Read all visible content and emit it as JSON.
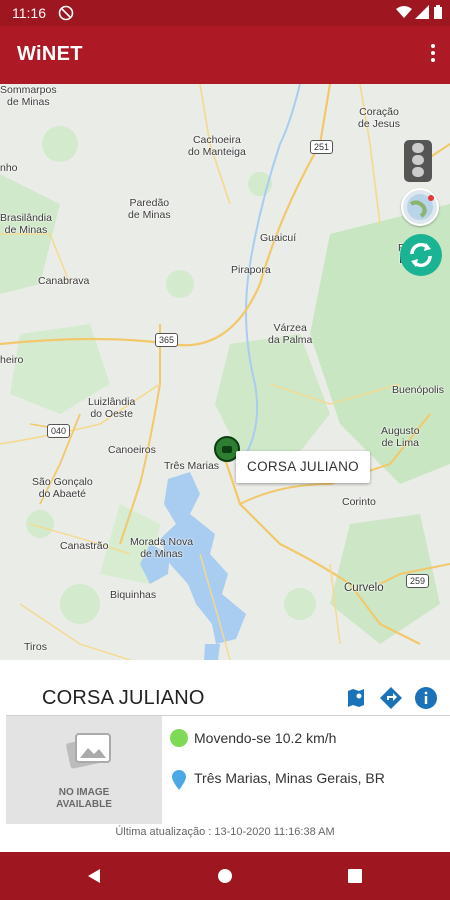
{
  "status_bar": {
    "time": "11:16",
    "icons": [
      "do-not-disturb-icon",
      "wifi-icon",
      "signal-icon",
      "battery-icon"
    ]
  },
  "app_bar": {
    "title": "WiNET",
    "menu_icon": "more-vert-icon",
    "bg_color": "#ad1a25"
  },
  "map": {
    "labels": {
      "cachoeira": "Cachoeira\ndo Manteiga",
      "coracao": "Coração\nde Jesus",
      "paredao": "Paredão\nde Minas",
      "brasilandia": "Brasilândia\nde Minas",
      "guaicui": "Guaicuí",
      "canabrava": "Canabrava",
      "pirapora": "Pirapora",
      "varzea": "Várzea\nda Palma",
      "heiro": "heiro",
      "luizlandia": "Luizlândia\ndo Oeste",
      "buenopolis": "Buenópolis",
      "canoeiros": "Canoeiros",
      "tresmarias": "Três Marias",
      "augusto": "Augusto\nde Lima",
      "saogoncalo": "São Gonçalo\ndo Abaeté",
      "corinto": "Corinto",
      "canastrao": "Canastrão",
      "moradanova": "Morada Nova\nde Minas",
      "curvelo": "Curvelo",
      "biquinhas": "Biquinhas",
      "tiros": "Tiros",
      "sminas": "Sommarpos\nde Minas",
      "francisco": "Fra\nDu",
      "nho": "nho"
    },
    "shields": {
      "r251": "251",
      "r365": "365",
      "r040": "040",
      "r259": "259"
    },
    "callout": "CORSA JULIANO",
    "controls": {
      "traffic": "traffic-light-icon",
      "globe": "globe-icon",
      "refresh": "refresh-icon",
      "refresh_color": "#1ab394"
    }
  },
  "vehicle": {
    "name": "CORSA JULIANO",
    "image_placeholder": "NO IMAGE\nAVAILABLE",
    "status": "Movendo-se 10.2 km/h",
    "status_color": "#7ed957",
    "location": "Três Marias, Minas Gerais, BR",
    "updated": "Última atualização : 13-10-2020 11:16:38 AM",
    "actions": [
      "map-person-icon",
      "directions-icon",
      "info-icon"
    ],
    "action_color": "#1a73b8"
  },
  "nav_bar": {
    "buttons": [
      "back-icon",
      "home-icon",
      "recents-icon"
    ]
  }
}
